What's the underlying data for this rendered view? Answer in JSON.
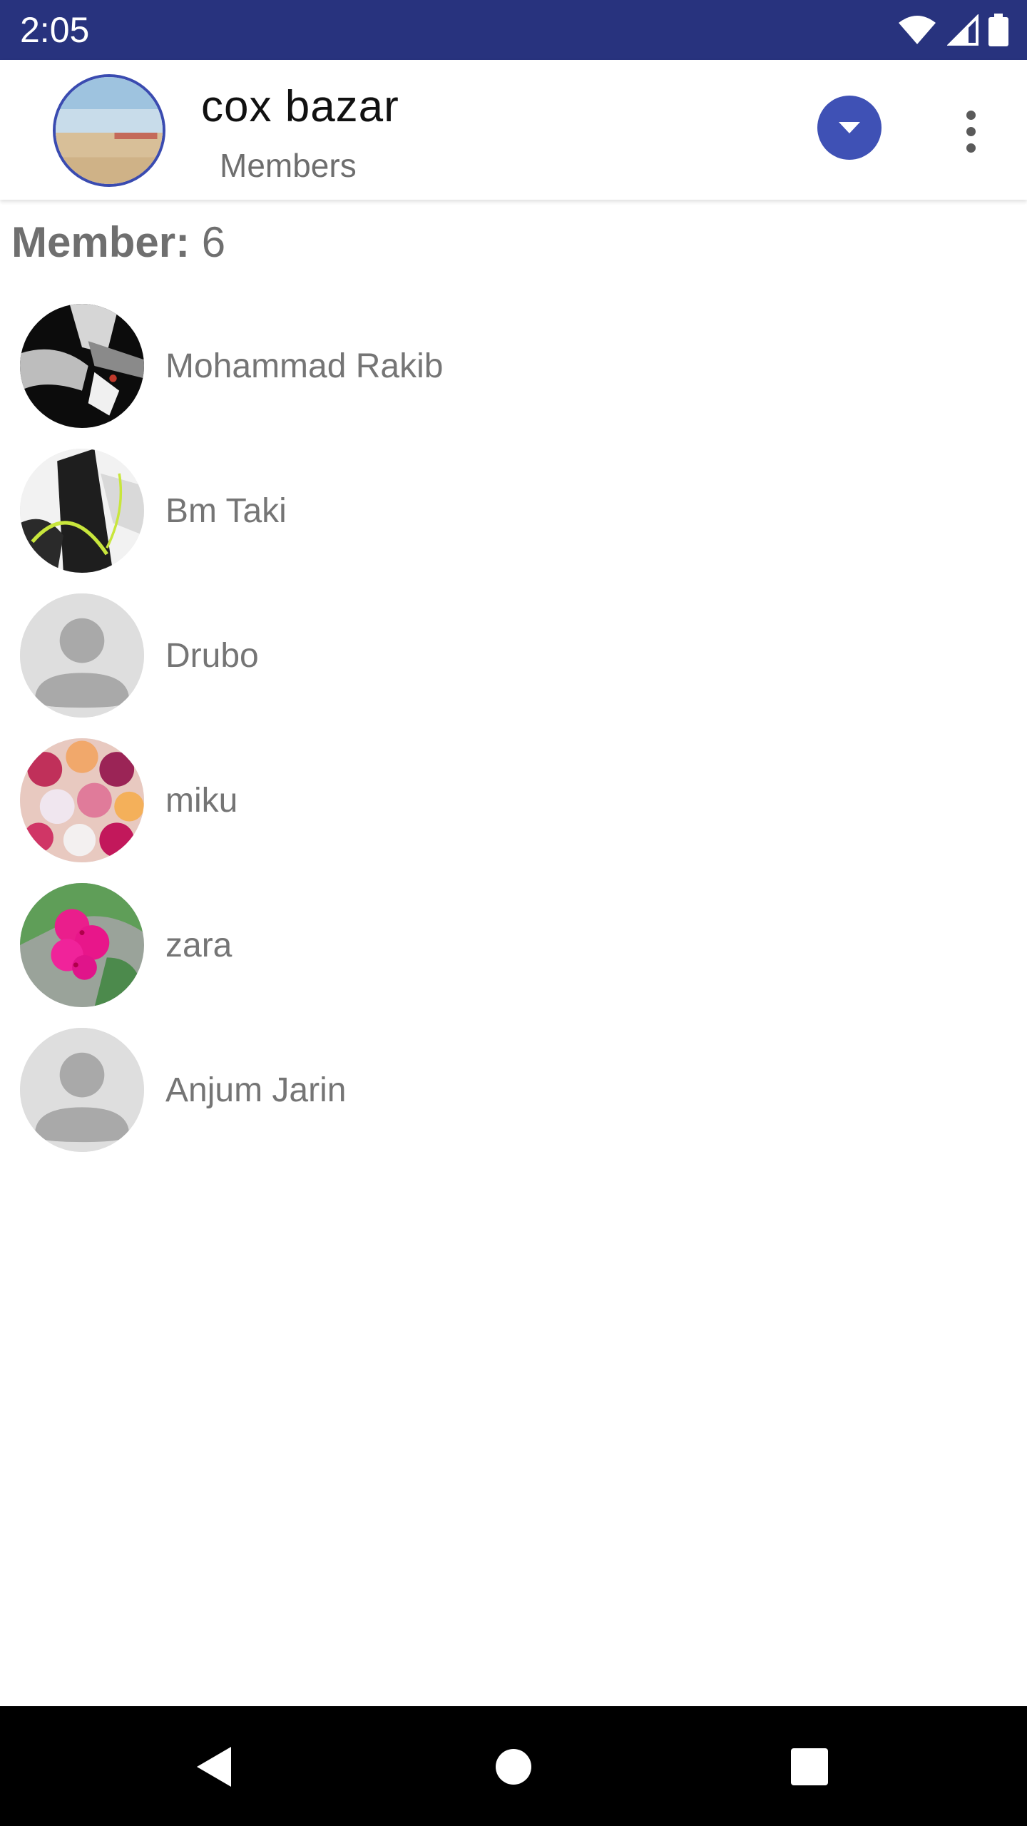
{
  "status_bar": {
    "time": "2:05",
    "icons": [
      "wifi-icon",
      "signal-icon",
      "battery-icon"
    ]
  },
  "toolbar": {
    "title": "cox bazar",
    "subtitle": "Members",
    "avatar_icon": "beach-photo",
    "dropdown_icon": "chevron-down-icon",
    "menu_icon": "more-vert-icon",
    "accent_color": "#3f51b5"
  },
  "members_header": {
    "label": "Member:",
    "count": "6"
  },
  "members": [
    {
      "name": "Mohammad Rakib",
      "avatar": "anime-dark-photo"
    },
    {
      "name": "Bm Taki",
      "avatar": "anime-sketch-photo"
    },
    {
      "name": "Drubo",
      "avatar": "default-person-icon"
    },
    {
      "name": "miku",
      "avatar": "flowers-photo"
    },
    {
      "name": "zara",
      "avatar": "pink-flower-photo"
    },
    {
      "name": "Anjum Jarin",
      "avatar": "default-person-icon"
    }
  ],
  "nav_bar": {
    "icons": [
      "back-icon",
      "home-icon",
      "recents-icon"
    ]
  },
  "colors": {
    "status_bar": "#28337e",
    "nav_bar": "#000000",
    "text_secondary": "#757575"
  }
}
